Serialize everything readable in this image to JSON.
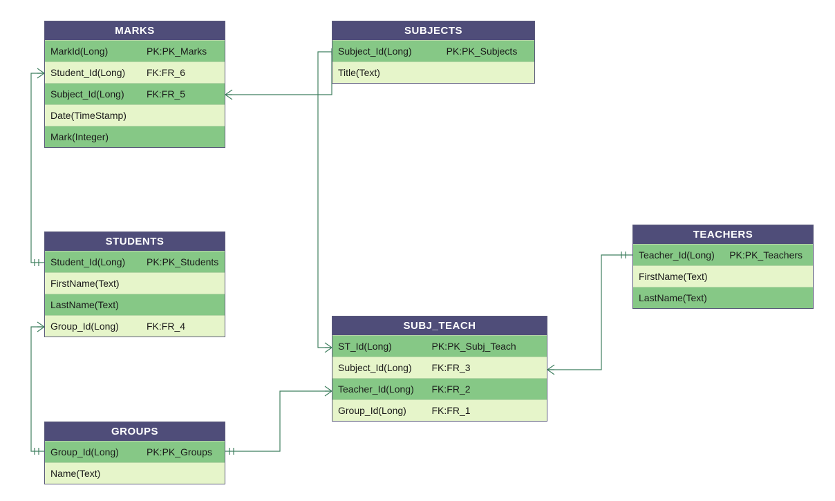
{
  "entities": {
    "marks": {
      "title": "MARKS",
      "rows": [
        {
          "name": "MarkId(Long)",
          "key": "PK:PK_Marks"
        },
        {
          "name": "Student_Id(Long)",
          "key": "FK:FR_6"
        },
        {
          "name": "Subject_Id(Long)",
          "key": "FK:FR_5"
        },
        {
          "name": "Date(TimeStamp)",
          "key": ""
        },
        {
          "name": "Mark(Integer)",
          "key": ""
        }
      ]
    },
    "subjects": {
      "title": "SUBJECTS",
      "rows": [
        {
          "name": "Subject_Id(Long)",
          "key": "PK:PK_Subjects"
        },
        {
          "name": "Title(Text)",
          "key": ""
        }
      ]
    },
    "students": {
      "title": "STUDENTS",
      "rows": [
        {
          "name": "Student_Id(Long)",
          "key": "PK:PK_Students"
        },
        {
          "name": "FirstName(Text)",
          "key": ""
        },
        {
          "name": "LastName(Text)",
          "key": ""
        },
        {
          "name": "Group_Id(Long)",
          "key": "FK:FR_4"
        }
      ]
    },
    "subj_teach": {
      "title": "SUBJ_TEACH",
      "rows": [
        {
          "name": "ST_Id(Long)",
          "key": "PK:PK_Subj_Teach"
        },
        {
          "name": "Subject_Id(Long)",
          "key": "FK:FR_3"
        },
        {
          "name": "Teacher_Id(Long)",
          "key": "FK:FR_2"
        },
        {
          "name": "Group_Id(Long)",
          "key": "FK:FR_1"
        }
      ]
    },
    "teachers": {
      "title": "TEACHERS",
      "rows": [
        {
          "name": "Teacher_Id(Long)",
          "key": "PK:PK_Teachers"
        },
        {
          "name": "FirstName(Text)",
          "key": ""
        },
        {
          "name": "LastName(Text)",
          "key": ""
        }
      ]
    },
    "groups": {
      "title": "GROUPS",
      "rows": [
        {
          "name": "Group_Id(Long)",
          "key": "PK:PK_Groups"
        },
        {
          "name": "Name(Text)",
          "key": ""
        }
      ]
    }
  },
  "colors": {
    "header": "#4f4d79",
    "row_dark": "#86c886",
    "row_light": "#e6f5ca",
    "connector": "#3f7f5f"
  }
}
